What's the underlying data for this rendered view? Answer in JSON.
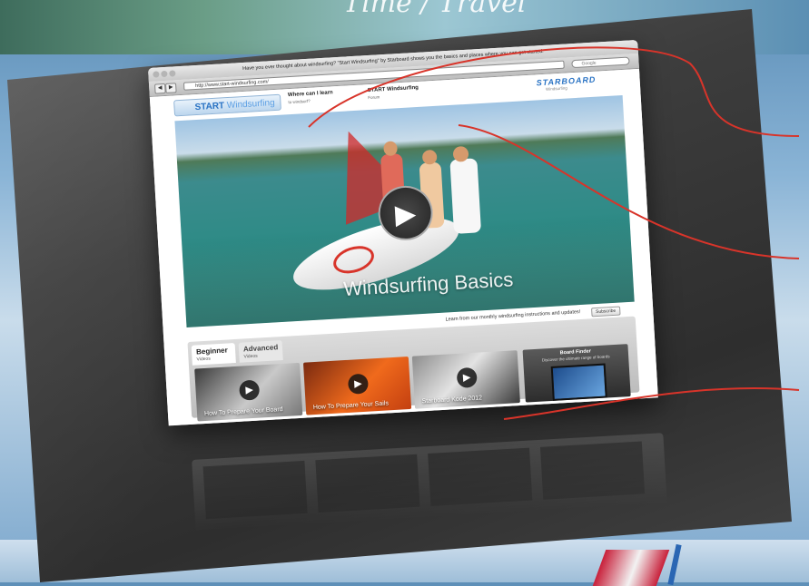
{
  "background": {
    "banner_script": "Time / Travel"
  },
  "browser": {
    "window_title": "Have you ever thought about windsurfing? \"Start Windsurfing\" by Starboard shows you the basics and places where you can get started.",
    "back_label": "◀",
    "forward_label": "▶",
    "url": "http://www.start-windsurfing.com/",
    "search_placeholder": "Google"
  },
  "site": {
    "logo_start": "START",
    "logo_word": "Windsurfing",
    "nav": [
      {
        "label": "Where can I learn",
        "sub": "to windsurf?"
      },
      {
        "label": "START Windsurfing",
        "sub": "Forum"
      }
    ],
    "brand": "STARBOARD",
    "brand_sub": "Windsurfing",
    "hero": {
      "title": "Windsurfing Basics",
      "play_icon": "play-icon"
    },
    "subscribe": {
      "text": "Learn from our monthly windsurfing instructions and updates!",
      "button": "Subscribe"
    },
    "tabs": [
      {
        "label": "Beginner",
        "sub": "Videos",
        "active": true
      },
      {
        "label": "Advanced",
        "sub": "Videos",
        "active": false
      }
    ],
    "videos": [
      {
        "caption": "How To Prepare Your Board"
      },
      {
        "caption": "How To Prepare Your Sails"
      },
      {
        "caption": "Starboard Kode 2012"
      }
    ],
    "board_finder": {
      "title": "Board Finder",
      "sub": "Discover the ultimate range of boards"
    }
  },
  "colors": {
    "accent": "#2a73c4",
    "callout_line": "#d8342a",
    "panel": "#3d3d3d"
  }
}
